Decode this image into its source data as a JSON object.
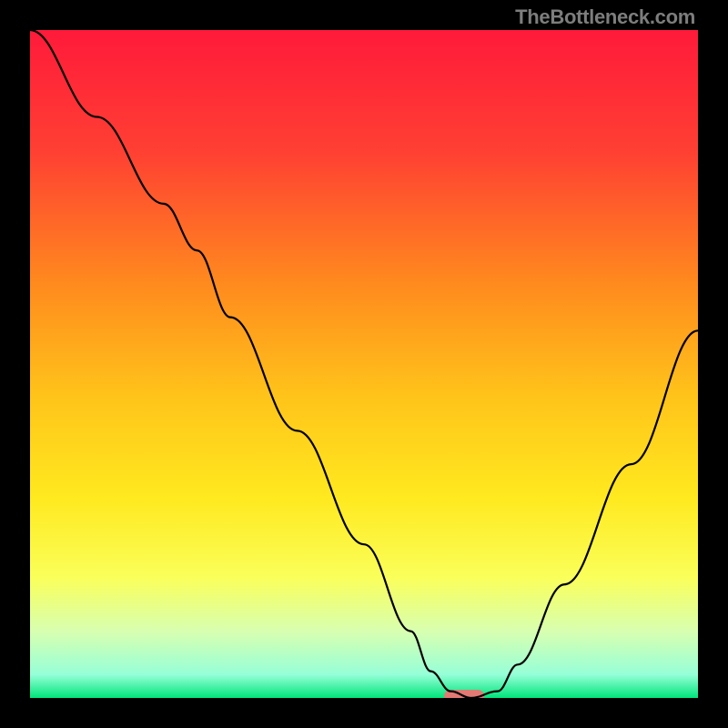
{
  "watermark": "TheBottleneck.com",
  "chart_data": {
    "type": "line",
    "title": "",
    "xlabel": "",
    "ylabel": "",
    "xlim": [
      0,
      100
    ],
    "ylim": [
      0,
      100
    ],
    "x": [
      0,
      10,
      20,
      25,
      30,
      40,
      50,
      57,
      60,
      63,
      66,
      70,
      73,
      80,
      90,
      100
    ],
    "values": [
      100,
      87,
      74,
      67,
      57,
      40,
      23,
      10,
      4,
      1,
      0,
      1,
      5,
      17,
      35,
      55
    ],
    "minimum_x": 66,
    "marker": {
      "x_start": 62,
      "x_end": 68,
      "y": 0
    },
    "gradient_stops": [
      {
        "pos": 0.0,
        "color": "#ff1a3a"
      },
      {
        "pos": 0.18,
        "color": "#ff3f33"
      },
      {
        "pos": 0.38,
        "color": "#ff8a1e"
      },
      {
        "pos": 0.55,
        "color": "#ffc41a"
      },
      {
        "pos": 0.7,
        "color": "#ffe91f"
      },
      {
        "pos": 0.82,
        "color": "#faff5a"
      },
      {
        "pos": 0.9,
        "color": "#d8ffb0"
      },
      {
        "pos": 0.965,
        "color": "#96ffd8"
      },
      {
        "pos": 1.0,
        "color": "#00e57a"
      }
    ],
    "marker_color": "#e27973",
    "line_color": "#000000"
  }
}
